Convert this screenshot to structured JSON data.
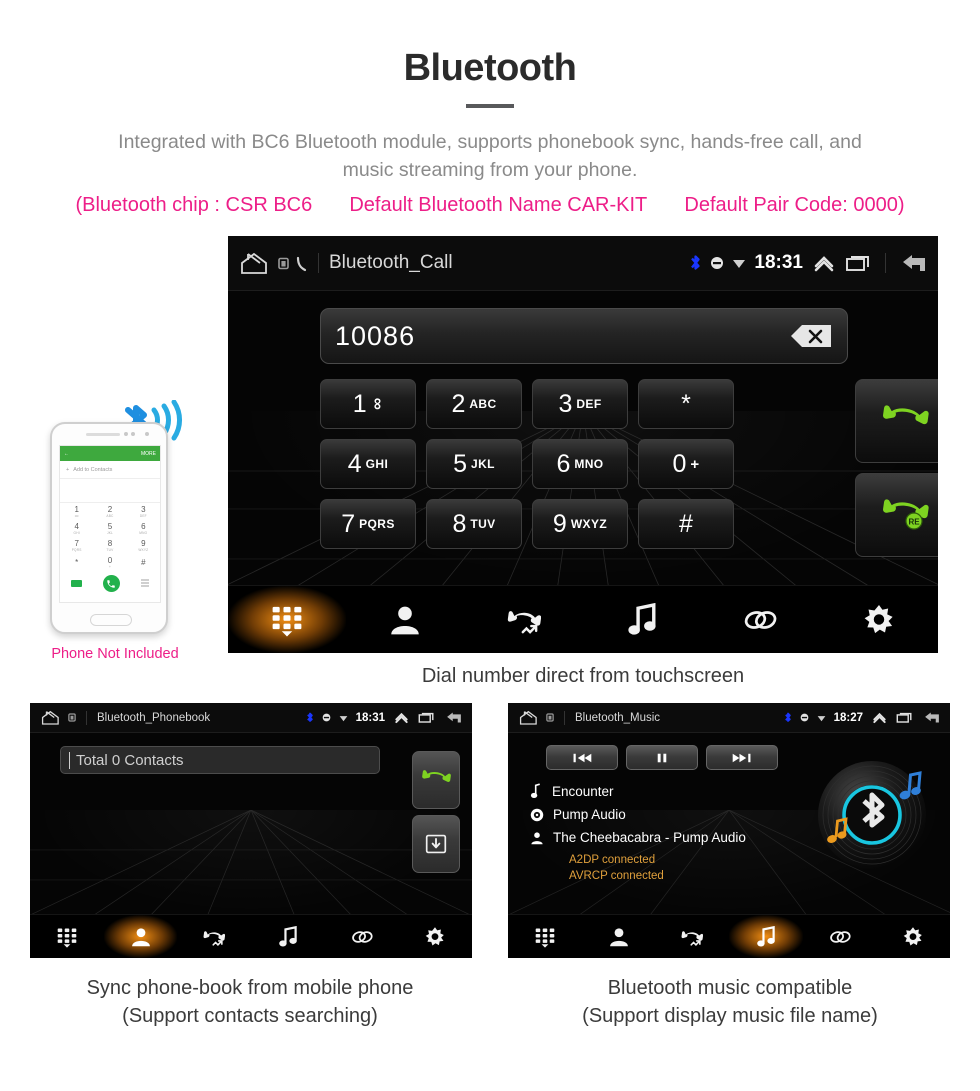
{
  "header": {
    "title": "Bluetooth",
    "subtitle_line1": "Integrated with BC6 Bluetooth module, supports phonebook sync, hands-free call, and",
    "subtitle_line2": "music streaming from your phone.",
    "spec_chip": "(Bluetooth chip : CSR BC6",
    "spec_name": "Default Bluetooth Name CAR-KIT",
    "spec_pair": "Default Pair Code: 0000)",
    "accent_pink": "#ed1e88",
    "title_color": "#2b2b2b",
    "subtitle_color": "#8a8a8a"
  },
  "main_screen": {
    "statusbar": {
      "title": "Bluetooth_Call",
      "time": "18:31",
      "icons": [
        "home-icon",
        "sim-icon",
        "phone-icon",
        "bluetooth-icon",
        "mute-icon",
        "wifi-icon",
        "chevron-up-icon",
        "recents-icon",
        "back-icon"
      ],
      "bluetooth_color": "#1a36ff"
    },
    "dial": {
      "number": "10086",
      "backspace_label": "backspace-icon"
    },
    "keys": [
      [
        {
          "digit": "1",
          "letters": "∞"
        },
        {
          "digit": "2",
          "letters": "ABC"
        },
        {
          "digit": "3",
          "letters": "DEF"
        },
        {
          "digit": "*",
          "letters": ""
        }
      ],
      [
        {
          "digit": "4",
          "letters": "GHI"
        },
        {
          "digit": "5",
          "letters": "JKL"
        },
        {
          "digit": "6",
          "letters": "MNO"
        },
        {
          "digit": "0",
          "letters": "+"
        }
      ],
      [
        {
          "digit": "7",
          "letters": "PQRS"
        },
        {
          "digit": "8",
          "letters": "TUV"
        },
        {
          "digit": "9",
          "letters": "WXYZ"
        },
        {
          "digit": "#",
          "letters": ""
        }
      ]
    ],
    "call_button": "call-icon",
    "redial_button": "redial-icon",
    "redial_badge": "RE",
    "nav": [
      {
        "name": "keypad",
        "icon": "keypad-icon",
        "active": true
      },
      {
        "name": "contacts",
        "icon": "contact-icon",
        "active": false
      },
      {
        "name": "call-history",
        "icon": "call-history-icon",
        "active": false
      },
      {
        "name": "music",
        "icon": "music-note-icon",
        "active": false
      },
      {
        "name": "link",
        "icon": "link-icon",
        "active": false
      },
      {
        "name": "settings",
        "icon": "gear-icon",
        "active": false
      }
    ],
    "caption": "Dial number direct from touchscreen"
  },
  "phonebook_screen": {
    "statusbar": {
      "title": "Bluetooth_Phonebook",
      "time": "18:31"
    },
    "search_value": "Total 0 Contacts",
    "call_button": "call-icon",
    "sync_button": "download-icon",
    "nav": [
      {
        "name": "keypad",
        "icon": "keypad-icon",
        "active": false
      },
      {
        "name": "contacts",
        "icon": "contact-icon",
        "active": true
      },
      {
        "name": "call-history",
        "icon": "call-history-icon",
        "active": false
      },
      {
        "name": "music",
        "icon": "music-note-icon",
        "active": false
      },
      {
        "name": "link",
        "icon": "link-icon",
        "active": false
      },
      {
        "name": "settings",
        "icon": "gear-icon",
        "active": false
      }
    ],
    "caption_line1": "Sync phone-book from mobile phone",
    "caption_line2": "(Support contacts searching)"
  },
  "music_screen": {
    "statusbar": {
      "title": "Bluetooth_Music",
      "time": "18:27"
    },
    "controls": [
      {
        "name": "previous",
        "icon": "previous-icon"
      },
      {
        "name": "pause",
        "icon": "pause-icon"
      },
      {
        "name": "next",
        "icon": "next-icon"
      }
    ],
    "track": "Encounter",
    "album": "Pump Audio",
    "artist": "The Cheebacabra - Pump Audio",
    "status_a2dp": "A2DP connected",
    "status_avrcp": "AVRCP connected",
    "status_color": "#e0a03c",
    "album_art": "vinyl-bluetooth-icon",
    "nav": [
      {
        "name": "keypad",
        "icon": "keypad-icon",
        "active": false
      },
      {
        "name": "contacts",
        "icon": "contact-icon",
        "active": false
      },
      {
        "name": "call-history",
        "icon": "call-history-icon",
        "active": false
      },
      {
        "name": "music",
        "icon": "music-note-icon",
        "active": true
      },
      {
        "name": "link",
        "icon": "link-icon",
        "active": false
      },
      {
        "name": "settings",
        "icon": "gear-icon",
        "active": false
      }
    ],
    "caption_line1": "Bluetooth music compatible",
    "caption_line2": "(Support display music file name)"
  },
  "phone_illustration": {
    "header_back": "←",
    "header_more": "MORE",
    "add_contacts": "Add to Contacts",
    "keys": [
      {
        "digit": "1",
        "sub": "oo"
      },
      {
        "digit": "2",
        "sub": "ABC"
      },
      {
        "digit": "3",
        "sub": "DEF"
      },
      {
        "digit": "4",
        "sub": "GHI"
      },
      {
        "digit": "5",
        "sub": "JKL"
      },
      {
        "digit": "6",
        "sub": "MNO"
      },
      {
        "digit": "7",
        "sub": "PQRS"
      },
      {
        "digit": "8",
        "sub": "TUV"
      },
      {
        "digit": "9",
        "sub": "WXYZ"
      },
      {
        "digit": "*",
        "sub": ""
      },
      {
        "digit": "0",
        "sub": "+"
      },
      {
        "digit": "#",
        "sub": ""
      }
    ],
    "disclaimer": "Phone Not Included",
    "disclaimer_color": "#ed1e88",
    "bluetooth_wave": "bluetooth-signal-icon"
  }
}
